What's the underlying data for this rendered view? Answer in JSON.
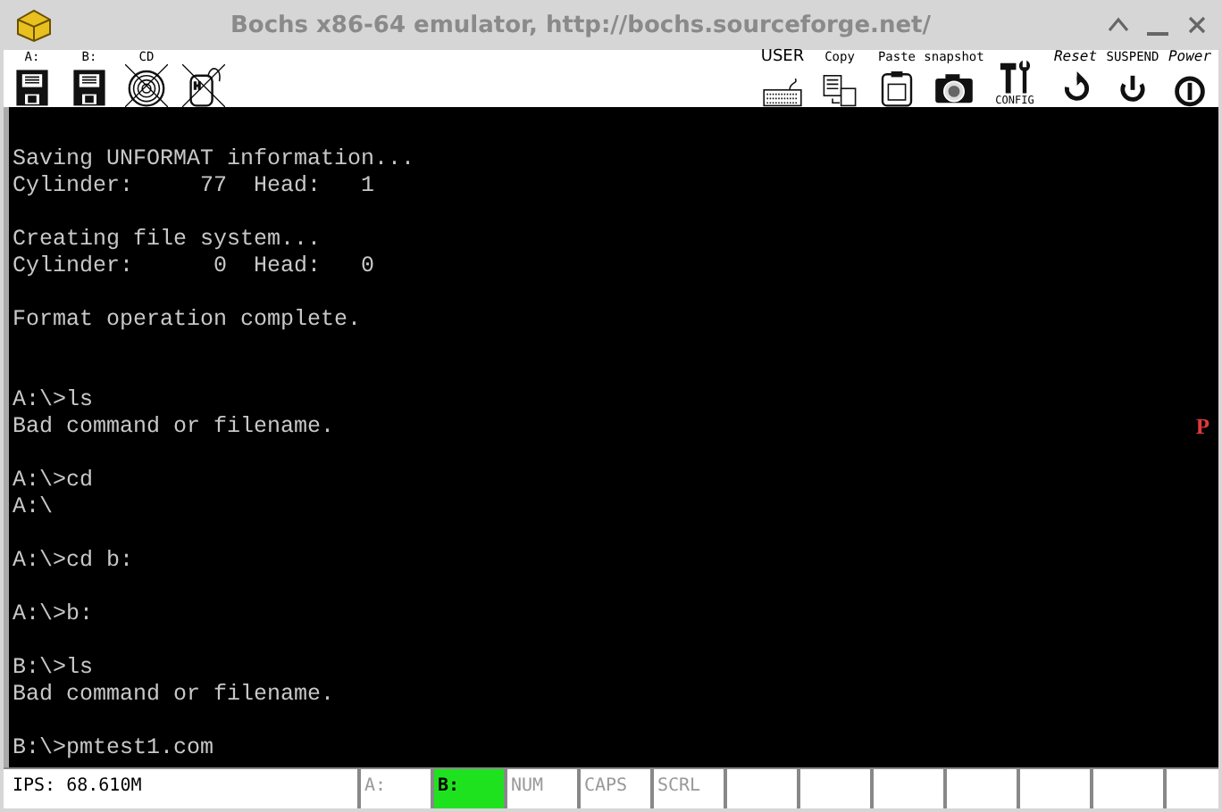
{
  "window": {
    "title": "Bochs x86-64 emulator, http://bochs.sourceforge.net/"
  },
  "toolbar": {
    "left": [
      {
        "kind": "floppy",
        "label": "A:",
        "disabled": false
      },
      {
        "kind": "floppy",
        "label": "B:",
        "disabled": false
      },
      {
        "kind": "cdrom",
        "label": "CD",
        "disabled": true
      },
      {
        "kind": "mouse",
        "disabled": true
      }
    ],
    "right": [
      {
        "kind": "keyboard",
        "label": "USER"
      },
      {
        "kind": "copy",
        "label": "Copy"
      },
      {
        "kind": "paste",
        "label": "Paste"
      },
      {
        "kind": "camera",
        "label": "snapshot"
      },
      {
        "kind": "config",
        "label": "CONFIG"
      },
      {
        "kind": "reset",
        "label": "Reset"
      },
      {
        "kind": "suspend",
        "label": "SUSPEND"
      },
      {
        "kind": "power",
        "label": "Power"
      }
    ]
  },
  "screen": {
    "lines": [
      {
        "kind": "blank"
      },
      {
        "kind": "text",
        "text": "Saving UNFORMAT information..."
      },
      {
        "kind": "text",
        "text": "Cylinder:     77  Head:   1"
      },
      {
        "kind": "blank"
      },
      {
        "kind": "text",
        "text": "Creating file system..."
      },
      {
        "kind": "text",
        "text": "Cylinder:      0  Head:   0"
      },
      {
        "kind": "blank"
      },
      {
        "kind": "text",
        "text": "Format operation complete."
      },
      {
        "kind": "blank"
      },
      {
        "kind": "blank"
      },
      {
        "kind": "text",
        "text": "A:\\>ls"
      },
      {
        "kind": "text",
        "text": "Bad command or filename.",
        "marker": "P"
      },
      {
        "kind": "blank"
      },
      {
        "kind": "text",
        "text": "A:\\>cd"
      },
      {
        "kind": "text",
        "text": "A:\\"
      },
      {
        "kind": "blank"
      },
      {
        "kind": "text",
        "text": "A:\\>cd b:"
      },
      {
        "kind": "blank"
      },
      {
        "kind": "text",
        "text": "A:\\>b:"
      },
      {
        "kind": "blank"
      },
      {
        "kind": "text",
        "text": "B:\\>ls"
      },
      {
        "kind": "text",
        "text": "Bad command or filename."
      },
      {
        "kind": "blank"
      },
      {
        "kind": "text",
        "text": "B:\\>pmtest1.com"
      }
    ]
  },
  "status_bar": {
    "ips": "IPS: 68.610M",
    "indicators": [
      {
        "label": "A:",
        "on": false
      },
      {
        "label": "B:",
        "on": true
      },
      {
        "label": "NUM",
        "on": false
      },
      {
        "label": "CAPS",
        "on": false
      },
      {
        "label": "SCRL",
        "on": false
      },
      {
        "on": false
      },
      {
        "on": false
      },
      {
        "on": false
      },
      {
        "on": false
      },
      {
        "on": false
      },
      {
        "on": false
      }
    ]
  }
}
